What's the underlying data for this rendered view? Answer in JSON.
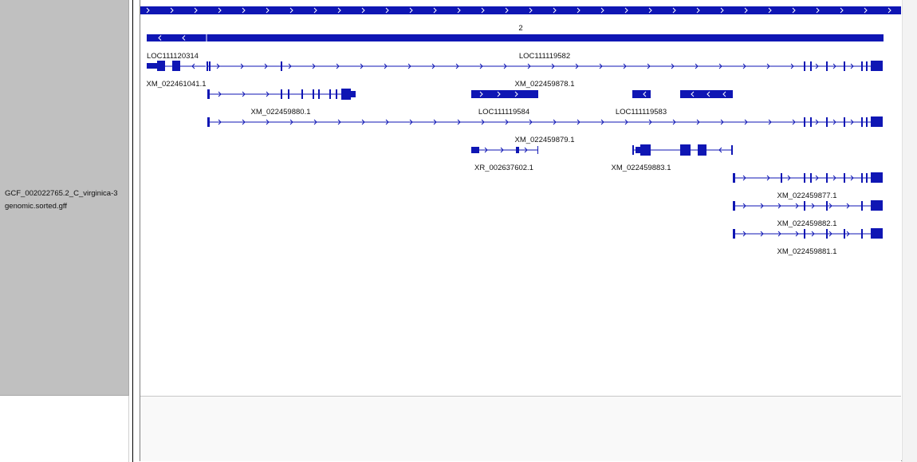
{
  "track": {
    "name": "GCF_002022765.2_C_virginica-3\ngenomic.sorted.gff"
  },
  "colors": {
    "feature": "#0f16b4",
    "panel_bg": "#c0c0c0"
  },
  "features": {
    "chromosome_label": "2",
    "loc111120314": "LOC111120314",
    "loc111119582": "LOC111119582",
    "xm_022461041": "XM_022461041.1",
    "xm_022459878": "XM_022459878.1",
    "xm_022459880": "XM_022459880.1",
    "loc111119584": "LOC111119584",
    "loc111119583": "LOC111119583",
    "xm_022459879": "XM_022459879.1",
    "xr_002637602": "XR_002637602.1",
    "xm_022459883": "XM_022459883.1",
    "xm_022459877": "XM_022459877.1",
    "xm_022459882": "XM_022459882.1",
    "xm_022459881": "XM_022459881.1"
  }
}
